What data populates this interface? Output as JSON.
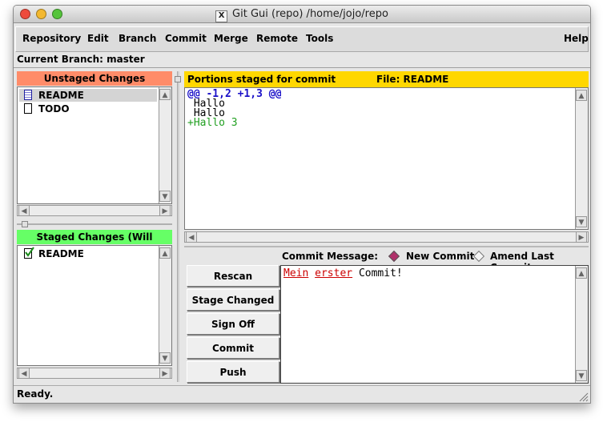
{
  "window": {
    "title": "Git Gui (repo) /home/jojo/repo",
    "title_icon": "X"
  },
  "menu": {
    "items": [
      "Repository",
      "Edit",
      "Branch",
      "Commit",
      "Merge",
      "Remote",
      "Tools"
    ],
    "help": "Help"
  },
  "branch": {
    "label": "Current Branch: master"
  },
  "unstaged": {
    "header": "Unstaged Changes",
    "header_color": "#ff8c69",
    "files": [
      {
        "name": "README",
        "icon": "modified-file-icon",
        "selected": true
      },
      {
        "name": "TODO",
        "icon": "file-icon",
        "selected": false
      }
    ]
  },
  "staged": {
    "header": "Staged Changes (Will Commit)",
    "header_color": "#66ff66",
    "files": [
      {
        "name": "README",
        "icon": "checkbox-checked-icon"
      }
    ]
  },
  "diff": {
    "header_left": "Portions staged for commit",
    "header_right": "File: README",
    "header_color": "#ffd700",
    "lines": [
      {
        "text": "@@ -1,2 +1,3 @@",
        "kind": "hunk"
      },
      {
        "text": " Hallo",
        "kind": "context"
      },
      {
        "text": " Hallo",
        "kind": "context"
      },
      {
        "text": "+Hallo 3",
        "kind": "added"
      }
    ]
  },
  "commit": {
    "message_label": "Commit Message:",
    "option_new": "New Commit",
    "option_amend": "Amend Last Commit",
    "selected_option": "New Commit",
    "message_words": [
      "Mein",
      "erster",
      "Commit!"
    ],
    "buttons": [
      "Rescan",
      "Stage Changed",
      "Sign Off",
      "Commit",
      "Push"
    ]
  },
  "status": {
    "text": "Ready."
  },
  "colors": {
    "hunk": "#1a10c8",
    "added": "#22a022",
    "misspelled": "#cc0000"
  }
}
